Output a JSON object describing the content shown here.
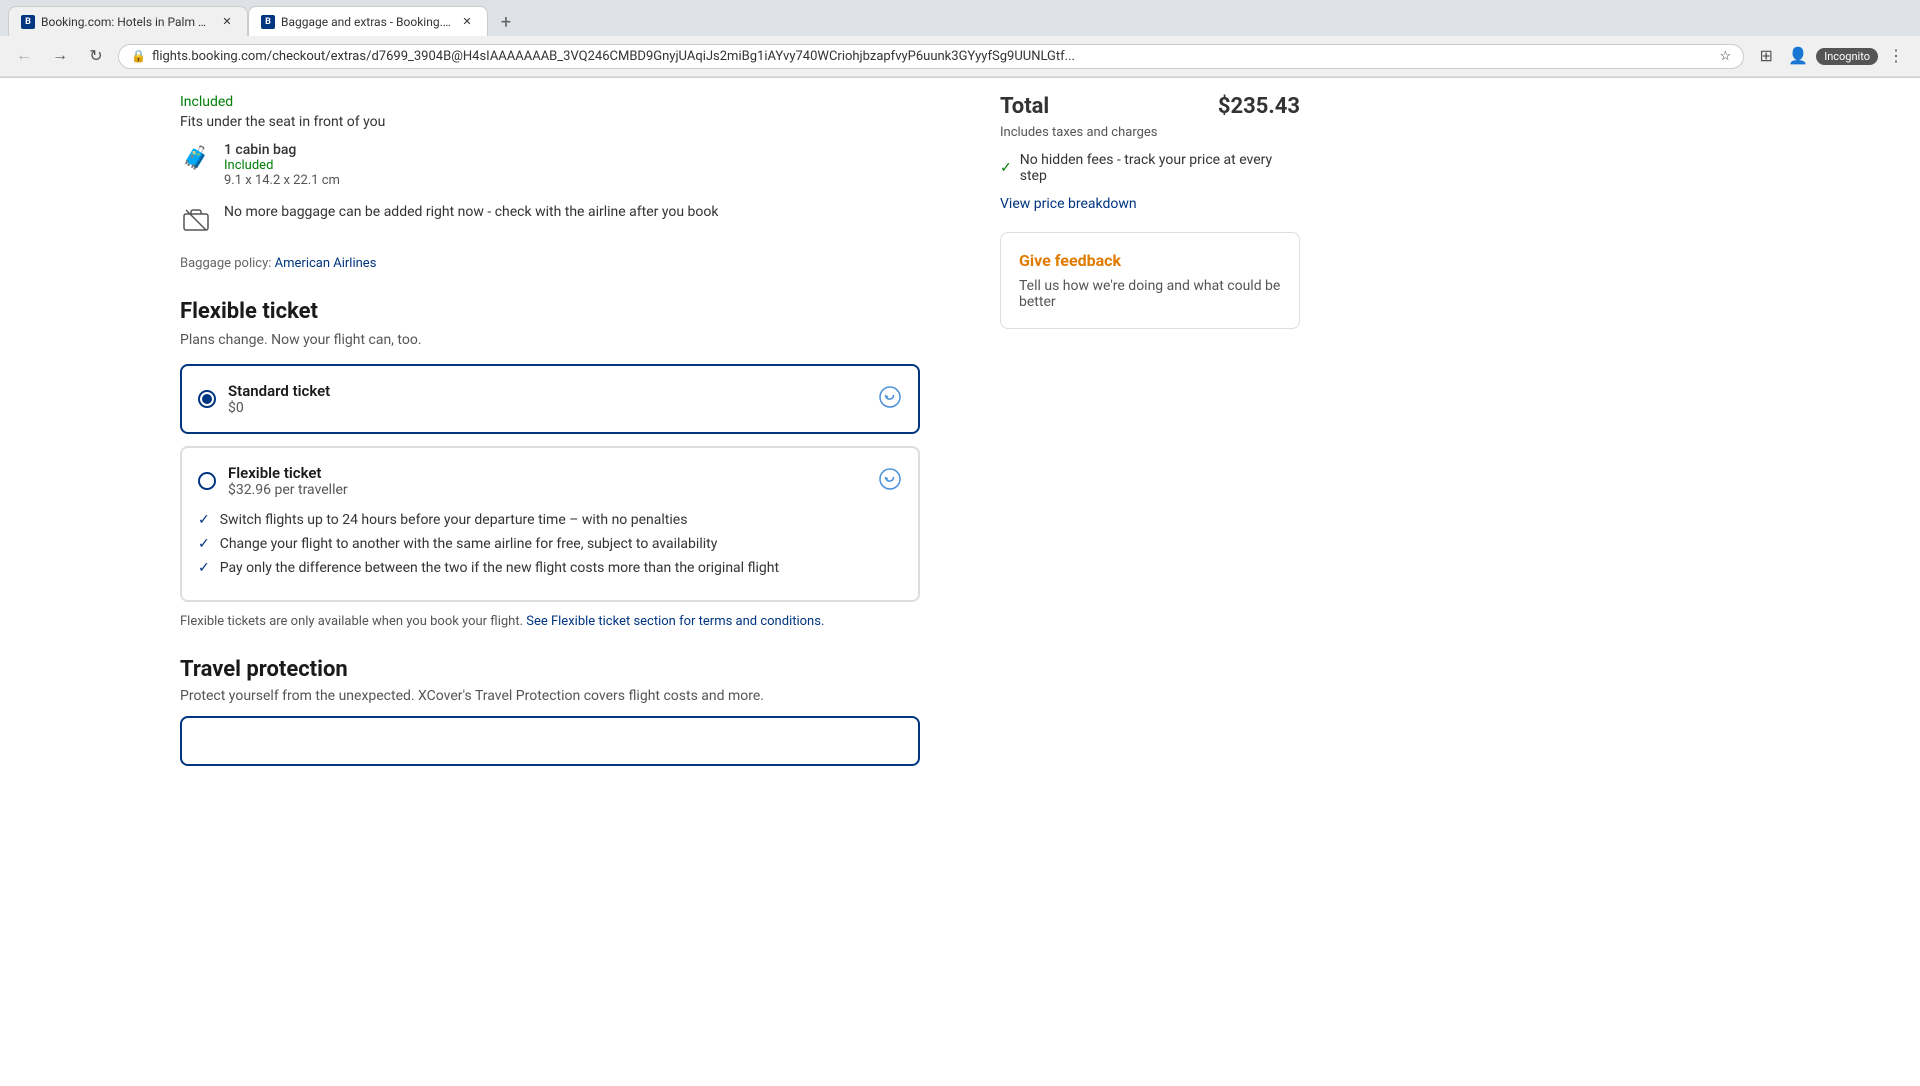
{
  "browser": {
    "tabs": [
      {
        "id": "tab1",
        "favicon": "B",
        "title": "Booking.com: Hotels in Palm Sp...",
        "active": false,
        "closeable": true
      },
      {
        "id": "tab2",
        "favicon": "B",
        "title": "Baggage and extras - Booking.c...",
        "active": true,
        "closeable": true
      }
    ],
    "new_tab_label": "+",
    "url": "flights.booking.com/checkout/extras/d7699_3904B@H4sIAAAAAAAB_3VQ246CMBD9GnyjUAqiJs2miBg1iAYvy740WCriohjbzapfvyP6uunk3GYyyfSg9UUNLGtf...",
    "nav": {
      "back": "←",
      "forward": "→",
      "reload": "↻"
    },
    "actions": {
      "star": "★",
      "incognito": "Incognito"
    }
  },
  "baggage": {
    "personal_item": {
      "included_label": "Included",
      "description": "Fits under the seat in front of you"
    },
    "cabin_bag": {
      "name": "1 cabin bag",
      "included_label": "Included",
      "dimensions": "9.1 x 14.2 x 22.1 cm"
    },
    "no_more": {
      "text": "No more baggage can be added right now - check with the airline after you book"
    },
    "policy": {
      "label": "Baggage policy:",
      "airline": "American Airlines",
      "airline_link": "#"
    }
  },
  "flexible_ticket": {
    "section_title": "Flexible ticket",
    "section_subtitle": "Plans change. Now your flight can, too.",
    "standard": {
      "name": "Standard ticket",
      "price": "$0",
      "selected": true
    },
    "flexible": {
      "name": "Flexible ticket",
      "price": "$32.96 per traveller",
      "selected": false,
      "features": [
        "Switch flights up to 24 hours before your departure time – with no penalties",
        "Change your flight to another with the same airline for free, subject to availability",
        "Pay only the difference between the two if the new flight costs more than the original flight"
      ]
    },
    "note": "Flexible tickets are only available when you book your flight.",
    "terms_link_text": "See Flexible ticket section for terms and conditions.",
    "terms_link": "#"
  },
  "travel_protection": {
    "section_title": "Travel protection",
    "section_subtitle": "Protect yourself from the unexpected. XCover's Travel Protection covers flight costs and more."
  },
  "sidebar": {
    "total_label": "Total",
    "total_amount": "$235.43",
    "total_subtitle": "Includes taxes and charges",
    "no_hidden_fees": "No hidden fees - track your price at every step",
    "view_breakdown": "View price breakdown",
    "feedback": {
      "title": "Give feedback",
      "text": "Tell us how we're doing and what could be better"
    }
  },
  "icons": {
    "personal_bag": "🎒",
    "cabin_bag": "🧳",
    "no_bag": "🚫",
    "refresh": "↻",
    "check": "✓"
  }
}
